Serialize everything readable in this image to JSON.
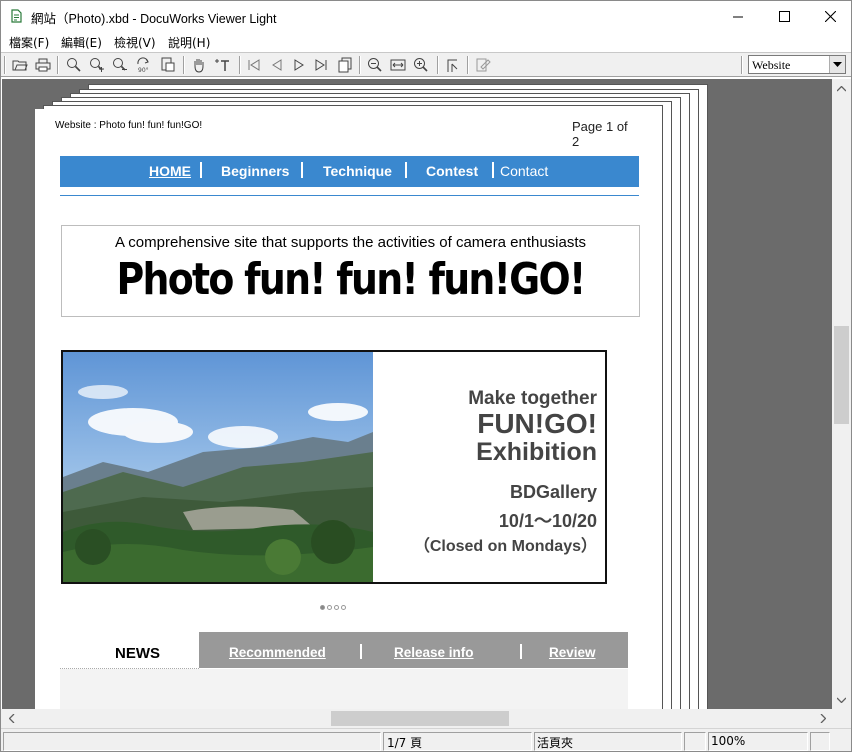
{
  "window": {
    "title": "網站（Photo).xbd - DocuWorks Viewer Light"
  },
  "menu": [
    {
      "label": "檔案(F)"
    },
    {
      "label": "編輯(E)"
    },
    {
      "label": "檢視(V)"
    },
    {
      "label": "說明(H)"
    }
  ],
  "toolbar": {
    "view_mode": "Website",
    "icons": [
      "open-icon",
      "print-icon",
      "zoom-tool-icon",
      "zoom-in-tool-icon",
      "zoom-out-tool-icon",
      "rotate-90-icon",
      "page-properties-icon",
      "hand-tool-icon",
      "text-select-icon",
      "first-page-icon",
      "prev-page-icon",
      "next-page-icon",
      "last-page-icon",
      "page-list-icon",
      "zoom-out-icon",
      "fit-width-icon",
      "zoom-in-icon",
      "annotation-pointer-icon",
      "annotation-props-icon"
    ]
  },
  "document": {
    "header_left": "Website : Photo fun! fun! fun!GO!",
    "header_right": "Page 1 of 2",
    "nav": [
      "HOME",
      "Beginners",
      "Technique",
      "Contest",
      "Contact"
    ],
    "tagline": "A comprehensive site that supports the activities of camera enthusiasts",
    "logo": "Photo fun! fun! fun!GO!",
    "banner": {
      "line1": "Make together",
      "line2": "FUN!GO!",
      "line3": "Exhibition",
      "line4": "BDGallery",
      "line5": "10/1～10/20",
      "line6": "（Closed on Mondays）"
    },
    "news_tab": "NEWS",
    "news_links": [
      "Recommended",
      "Release info",
      "Review"
    ],
    "slider_dots": 4,
    "slider_active": 0
  },
  "status": {
    "page": "1/7 頁",
    "mode": "活頁夾",
    "zoom": "100%"
  },
  "colors": {
    "nav_blue": "#3a88cf",
    "viewport_gray": "#6b6b6b",
    "news_gray": "#999999",
    "banner_text": "#444444"
  }
}
